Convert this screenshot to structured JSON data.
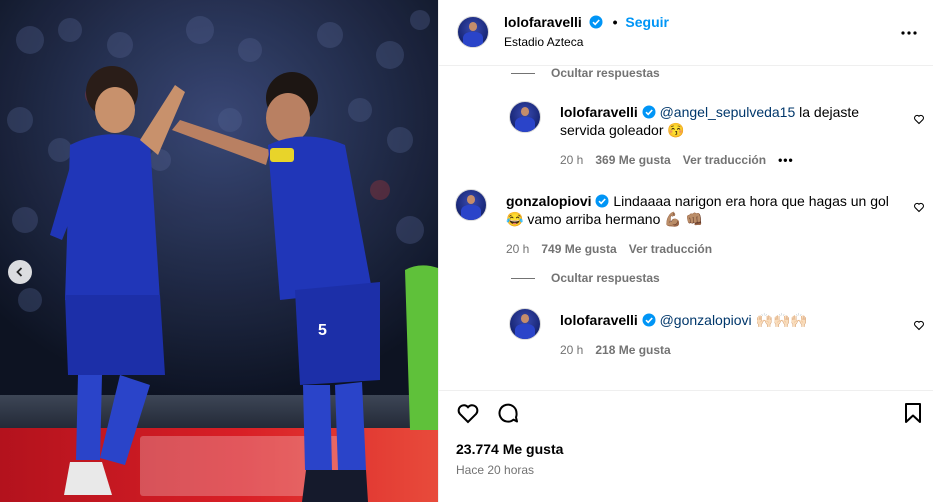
{
  "header": {
    "username": "lolofaravelli",
    "separator": "•",
    "follow_label": "Seguir",
    "location": "Estadio Azteca",
    "more_icon": "more-horizontal-icon"
  },
  "comments": {
    "hide_replies_1": "Ocultar respuestas",
    "reply_1": {
      "username": "lolofaravelli",
      "mention": "@angel_sepulveda15",
      "text": " la dejaste servida goleador 😚",
      "time": "20 h",
      "likes": "369 Me gusta",
      "translate": "Ver traducción",
      "more": "•••"
    },
    "comment_2": {
      "username": "gonzalopiovi",
      "text": " Lindaaaa narigon era hora que hagas un gol 😂 vamo arriba hermano 💪🏽 👊🏽",
      "time": "20 h",
      "likes": "749 Me gusta",
      "translate": "Ver traducción"
    },
    "hide_replies_2": "Ocultar respuestas",
    "reply_2": {
      "username": "lolofaravelli",
      "mention": "@gonzalopiovi",
      "text": " 🙌🏻🙌🏻🙌🏻",
      "time": "20 h",
      "likes": "218 Me gusta"
    }
  },
  "actions": {
    "likes_total": "23.774 Me gusta",
    "time_ago": "Hace 20 horas"
  },
  "colors": {
    "link_blue": "#0095f6",
    "mention_blue": "#00376b",
    "secondary_text": "#737373",
    "verified_blue": "#0095f6"
  }
}
